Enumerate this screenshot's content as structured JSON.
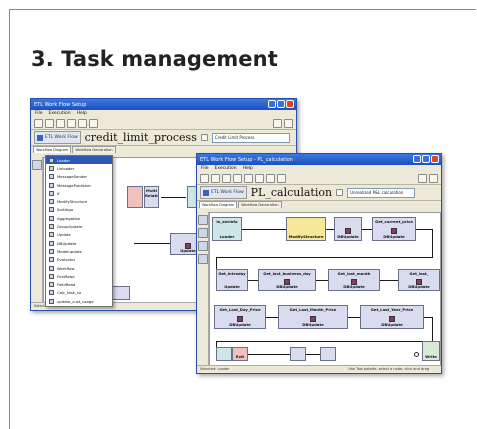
{
  "slide": {
    "title": "3. Task management"
  },
  "window_back": {
    "title": "ETL Work Flow Setup",
    "menu": [
      "File",
      "Execution",
      "Help"
    ],
    "etl_label": "ETL Work Flow",
    "flow_name": "credit_limit_process",
    "flow_input": "Credit Limit Process",
    "tabs": [
      "Workflow Diagram",
      "Workflow Declaration"
    ],
    "status": "Selected: Tool palette item",
    "dropdown": [
      {
        "label": "Loader",
        "icon": "loader-icon",
        "highlighted": true
      },
      {
        "label": "Unloader",
        "icon": "unloader-icon"
      },
      {
        "label": "MessageSender",
        "icon": "message-sender-icon"
      },
      {
        "label": "MessagePublisher",
        "icon": "message-publisher-icon"
      },
      {
        "label": "If",
        "icon": "if-icon"
      },
      {
        "label": "ModifyStructure",
        "icon": "modify-structure-icon"
      },
      {
        "label": "SortAlgo",
        "icon": "sort-icon"
      },
      {
        "label": "Aggregation",
        "icon": "aggregation-icon"
      },
      {
        "label": "GroupUpdate",
        "icon": "group-update-icon"
      },
      {
        "label": "Update",
        "icon": "update-icon"
      },
      {
        "label": "DBUpdate",
        "icon": "db-update-icon"
      },
      {
        "label": "Modelupdate",
        "icon": "model-update-icon"
      },
      {
        "label": "Evaluator",
        "icon": "evaluator-icon"
      },
      {
        "label": "Workflow",
        "icon": "workflow-icon"
      },
      {
        "label": "FirstRead",
        "icon": "first-read-icon"
      },
      {
        "label": "FieldRead",
        "icon": "field-read-icon"
      },
      {
        "label": "Calc_task_co",
        "icon": "calc-icon"
      },
      {
        "label": "update_cust_usage",
        "icon": "usage-icon"
      }
    ],
    "nodes": [
      {
        "label": "Multi Relation",
        "sub": ""
      },
      {
        "label": "Multi Relation",
        "sub": ""
      },
      {
        "label": "",
        "sub": "Update"
      },
      {
        "label": "",
        "sub": ""
      }
    ]
  },
  "window_front": {
    "title": "ETL Work Flow Setup - PL_calculation",
    "menu": [
      "File",
      "Execution",
      "Help"
    ],
    "etl_label": "ETL Work Flow",
    "flow_name": "PL_calculation",
    "flow_input": "Unrealized P&L calculation",
    "tabs": [
      "Workflow Diagram",
      "Workflow Declaration"
    ],
    "status": "Selected: Loader",
    "zoom_text": "Use Tool palette, select a node, click and drag",
    "nodes": [
      {
        "label": "in_secinfo",
        "sub": "Loader"
      },
      {
        "label": "",
        "sub": "ModifyStructure"
      },
      {
        "label": "",
        "sub": "DBUpdate"
      },
      {
        "label": "Get_current_price",
        "sub": "DBUpdate"
      },
      {
        "label": "Get_intraday",
        "sub": "Update"
      },
      {
        "label": "Get_last_business_day",
        "sub": "DBUpdate"
      },
      {
        "label": "Get_last_month",
        "sub": "DBUpdate"
      },
      {
        "label": "Get_last_",
        "sub": "DBUpdate"
      },
      {
        "label": "Get_Last_Day_Price",
        "sub": "DBUpdate"
      },
      {
        "label": "Get_Last_Month_Price",
        "sub": "DBUpdate"
      },
      {
        "label": "Get_Last_Year_Price",
        "sub": "DBUpdate"
      },
      {
        "label": "",
        "sub": "Exit"
      },
      {
        "label": "",
        "sub": "Write"
      }
    ]
  },
  "colors": {
    "titlebar": "#1d4fc0",
    "menu_highlight": "#2e58b8",
    "node_default": "#d9dcee",
    "node_yellow": "#f6e79a",
    "node_pink": "#f0c1bf"
  }
}
